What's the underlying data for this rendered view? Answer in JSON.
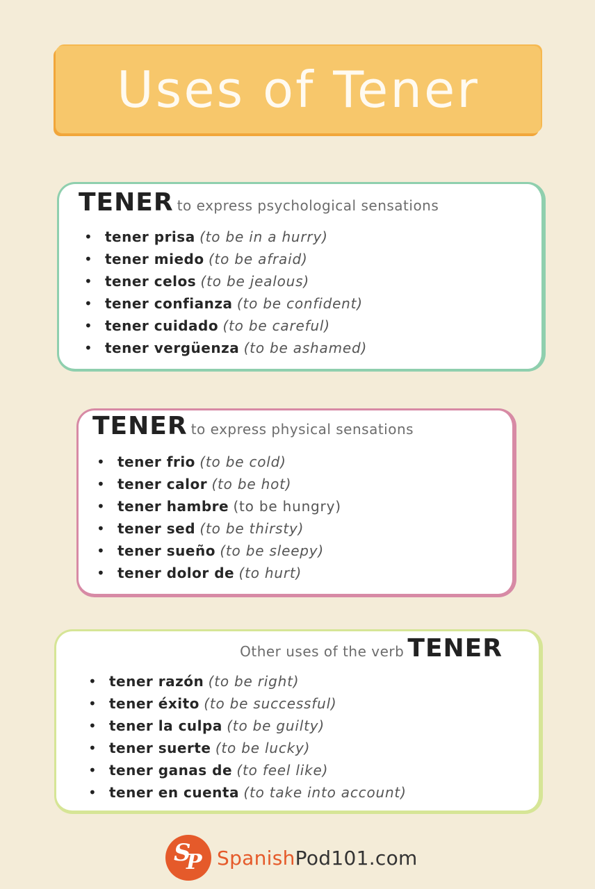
{
  "title": "Uses of Tener",
  "sections": [
    {
      "verb": "TENER",
      "subtitle": "to express psychological sensations",
      "items": [
        {
          "term": "tener prisa",
          "meaning": "(to be in a hurry)"
        },
        {
          "term": "tener miedo",
          "meaning": "(to be afraid)"
        },
        {
          "term": "tener celos",
          "meaning": "(to be jealous)"
        },
        {
          "term": "tener confianza",
          "meaning": "(to be confident)"
        },
        {
          "term": "tener cuidado",
          "meaning": "(to be careful)"
        },
        {
          "term": "tener vergüenza",
          "meaning": "(to be ashamed)"
        }
      ]
    },
    {
      "verb": "TENER",
      "subtitle": "to express physical sensations",
      "items": [
        {
          "term": "tener frio",
          "meaning": "(to be cold)"
        },
        {
          "term": "tener calor",
          "meaning": "(to be hot)"
        },
        {
          "term": "tener hambre",
          "meaning": "(to be hungry)"
        },
        {
          "term": "tener sed",
          "meaning": "(to be thirsty)"
        },
        {
          "term": "tener sueño",
          "meaning": "(to be sleepy)"
        },
        {
          "term": "tener dolor de",
          "meaning": " (to hurt)"
        }
      ]
    },
    {
      "verb": "TENER",
      "subtitle": "Other uses of the verb",
      "items": [
        {
          "term": "tener razón",
          "meaning": "(to be right)"
        },
        {
          "term": "tener éxito",
          "meaning": "(to be successful)"
        },
        {
          "term": "tener la culpa",
          "meaning": "(to be guilty)"
        },
        {
          "term": "tener suerte",
          "meaning": "(to be lucky)"
        },
        {
          "term": "tener ganas de",
          "meaning": "(to feel like)"
        },
        {
          "term": "tener en cuenta",
          "meaning": "(to take into account)"
        }
      ]
    }
  ],
  "footer": {
    "logo_letters": "SP",
    "brand_part1": "Spanish",
    "brand_part2": "Pod101.com"
  },
  "colors": {
    "background": "#f4ecd8",
    "title_banner": "#f7c76b",
    "section1_border": "#8fcfae",
    "section2_border": "#d78aa5",
    "section3_border": "#d6e596",
    "brand_orange": "#e55a2a"
  },
  "bullet_icon": "bullet-dot"
}
